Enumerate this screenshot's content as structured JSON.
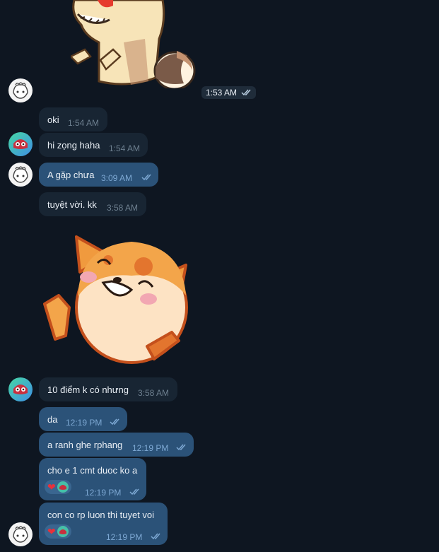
{
  "colors": {
    "background": "#0e1621",
    "incoming_bubble": "#182533",
    "outgoing_bubble": "#2b5278",
    "time_incoming": "#6d7f8f",
    "time_outgoing": "#7da8d3",
    "tick_color": "#7da8d3"
  },
  "sticker_top": {
    "name": "raccoon-sticker",
    "time": "1:53 AM",
    "read": true
  },
  "messages": [
    {
      "text": "oki",
      "time": "1:54 AM",
      "type": "incoming",
      "read": false
    },
    {
      "text": "hi zọng haha",
      "time": "1:54 AM",
      "type": "incoming",
      "read": false
    },
    {
      "text": "A gặp chưa",
      "time": "3:09 AM",
      "type": "outgoing",
      "read": true
    },
    {
      "text": "tuyệt vời. kk",
      "time": "3:58 AM",
      "type": "incoming",
      "read": false
    },
    {
      "text": "10 điểm k có nhưng",
      "time": "3:58 AM",
      "type": "incoming",
      "read": false
    },
    {
      "text": "da",
      "time": "12:19 PM",
      "type": "outgoing",
      "read": true
    },
    {
      "text": "a ranh ghe rphang",
      "time": "12:19 PM",
      "type": "outgoing",
      "read": true
    },
    {
      "text": "cho e 1 cmt duoc ko a",
      "time": "12:19 PM",
      "type": "outgoing",
      "read": true,
      "reactions": [
        "heart-icon",
        "avatar-small"
      ]
    },
    {
      "text": "con co rp luon thi tuyet voi",
      "time": "12:19 PM",
      "type": "outgoing",
      "read": true,
      "reactions": [
        "heart-icon",
        "avatar-small"
      ]
    }
  ],
  "sticker_middle": {
    "name": "fox-sticker"
  }
}
